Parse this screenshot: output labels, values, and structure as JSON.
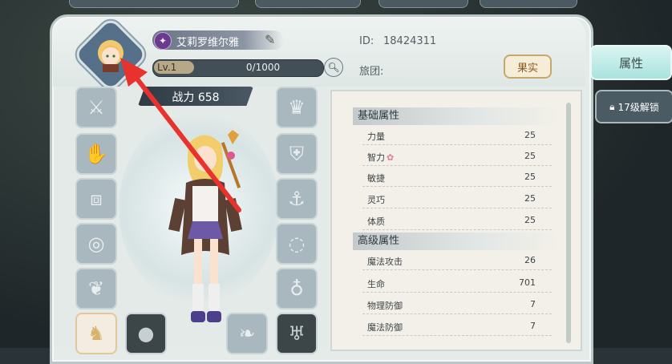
{
  "header": {
    "player_name": "艾莉罗维尔雅",
    "id_label": "ID:",
    "id_value": "18424311",
    "guild_label": "旅团:",
    "level_label": "Lv.1",
    "exp_text": "0/1000",
    "fruit_button": "果实"
  },
  "power": {
    "label": "战力 658"
  },
  "side_tabs": {
    "attributes": "属性",
    "unlock": "17级解锁"
  },
  "stats": {
    "basic_title": "基础属性",
    "basic": [
      {
        "name": "力量",
        "value": "25"
      },
      {
        "name": "智力",
        "value": "25"
      },
      {
        "name": "敏捷",
        "value": "25"
      },
      {
        "name": "灵巧",
        "value": "25"
      },
      {
        "name": "体质",
        "value": "25"
      }
    ],
    "advanced_title": "高级属性",
    "advanced": [
      {
        "name": "魔法攻击",
        "value": "26"
      },
      {
        "name": "生命",
        "value": "701"
      },
      {
        "name": "物理防御",
        "value": "7"
      },
      {
        "name": "魔法防御",
        "value": "7"
      }
    ]
  },
  "equipment_slots": {
    "left": [
      "sword-icon",
      "glove-icon",
      "pants-icon",
      "bracelet-icon",
      "emblem-icon"
    ],
    "right": [
      "helmet-icon",
      "armor-icon",
      "boots-icon",
      "necklace-icon",
      "ring-icon"
    ],
    "bottom": [
      "mount-icon",
      "orb-icon",
      "wing-icon",
      "cup-icon"
    ]
  },
  "colors": {
    "accent": "#a9e3de",
    "annotation_arrow": "#e8322d"
  }
}
